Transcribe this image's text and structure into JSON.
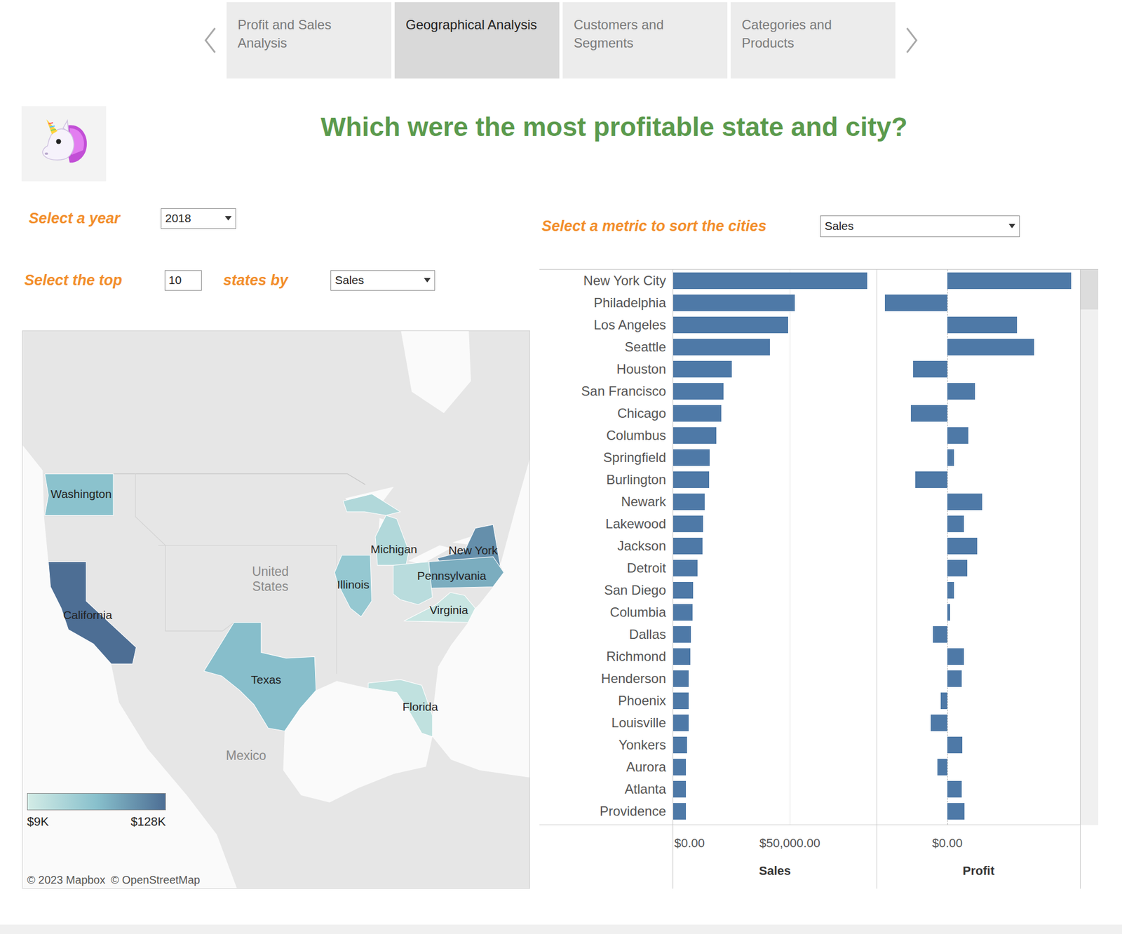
{
  "tabs": [
    {
      "label": "Profit and Sales Analysis",
      "selected": false
    },
    {
      "label": "Geographical Analysis",
      "selected": true
    },
    {
      "label": "Customers and Segments",
      "selected": false
    },
    {
      "label": "Categories and Products",
      "selected": false
    }
  ],
  "title": "Which were the most profitable state and city?",
  "filters": {
    "year_label": "Select a year",
    "year": "2018",
    "top_label": "Select the top",
    "top_n": "10",
    "states_by_label": "states by",
    "states_by": "Sales",
    "sort_label": "Select a metric to sort the cities",
    "sort_by": "Sales"
  },
  "map": {
    "states": [
      {
        "kind": "california",
        "label": "California",
        "sales": 128000
      },
      {
        "kind": "newyork",
        "label": "New York",
        "sales": 104000
      },
      {
        "kind": "pennsylvania",
        "label": "Pennsylvania",
        "sales": 82000
      },
      {
        "kind": "texas",
        "label": "Texas",
        "sales": 70000
      },
      {
        "kind": "washington",
        "label": "Washington",
        "sales": 66000
      },
      {
        "kind": "illinois",
        "label": "Illinois",
        "sales": 58000
      },
      {
        "kind": "michigan",
        "label": "Michigan",
        "sales": 36000
      },
      {
        "kind": "ohio",
        "label": "",
        "sales": 30000
      },
      {
        "kind": "florida",
        "label": "Florida",
        "sales": 24000
      },
      {
        "kind": "virginia",
        "label": "Virginia",
        "sales": 18000
      }
    ],
    "country_labels": [
      {
        "kind": "usa",
        "label": "United States"
      },
      {
        "kind": "mexico",
        "label": "Mexico"
      }
    ],
    "legend": {
      "min_label": "$9K",
      "max_label": "$128K",
      "min": 9000,
      "max": 128000
    },
    "attribution": [
      "© 2023 Mapbox",
      "© OpenStreetMap"
    ]
  },
  "chart": {
    "cities": [
      {
        "name": "New York City",
        "sales": 83100,
        "profit": 18210
      },
      {
        "name": "Philadelphia",
        "sales": 52150,
        "profit": -9160
      },
      {
        "name": "Los Angeles",
        "sales": 49400,
        "profit": 10210
      },
      {
        "name": "Seattle",
        "sales": 41400,
        "profit": 12740
      },
      {
        "name": "Houston",
        "sales": 25150,
        "profit": -5050
      },
      {
        "name": "San Francisco",
        "sales": 21470,
        "profit": 4100
      },
      {
        "name": "Chicago",
        "sales": 20550,
        "profit": -5370
      },
      {
        "name": "Columbus",
        "sales": 18400,
        "profit": 3050
      },
      {
        "name": "Springfield",
        "sales": 15650,
        "profit": 950
      },
      {
        "name": "Burlington",
        "sales": 15340,
        "profit": -4740
      },
      {
        "name": "Newark",
        "sales": 13500,
        "profit": 5160
      },
      {
        "name": "Lakewood",
        "sales": 12880,
        "profit": 2420
      },
      {
        "name": "Jackson",
        "sales": 12580,
        "profit": 4420
      },
      {
        "name": "Detroit",
        "sales": 10430,
        "profit": 2950
      },
      {
        "name": "San Diego",
        "sales": 8590,
        "profit": 950
      },
      {
        "name": "Columbia",
        "sales": 8280,
        "profit": 420
      },
      {
        "name": "Dallas",
        "sales": 7670,
        "profit": -2100
      },
      {
        "name": "Richmond",
        "sales": 7360,
        "profit": 2420
      },
      {
        "name": "Henderson",
        "sales": 6750,
        "profit": 2100
      },
      {
        "name": "Phoenix",
        "sales": 6750,
        "profit": -950
      },
      {
        "name": "Louisville",
        "sales": 6750,
        "profit": -2420
      },
      {
        "name": "Yonkers",
        "sales": 5830,
        "profit": 2210
      },
      {
        "name": "Aurora",
        "sales": 5520,
        "profit": -1470
      },
      {
        "name": "Atlanta",
        "sales": 5520,
        "profit": 2100
      },
      {
        "name": "Providence",
        "sales": 5520,
        "profit": 2530
      }
    ],
    "sales_axis": {
      "title": "Sales",
      "ticks": [
        {
          "label": "$0.00",
          "value": 0
        },
        {
          "label": "$50,000.00",
          "value": 50000
        }
      ]
    },
    "profit_axis": {
      "title": "Profit",
      "ticks": [
        {
          "label": "$0.00",
          "value": 0
        }
      ]
    }
  }
}
